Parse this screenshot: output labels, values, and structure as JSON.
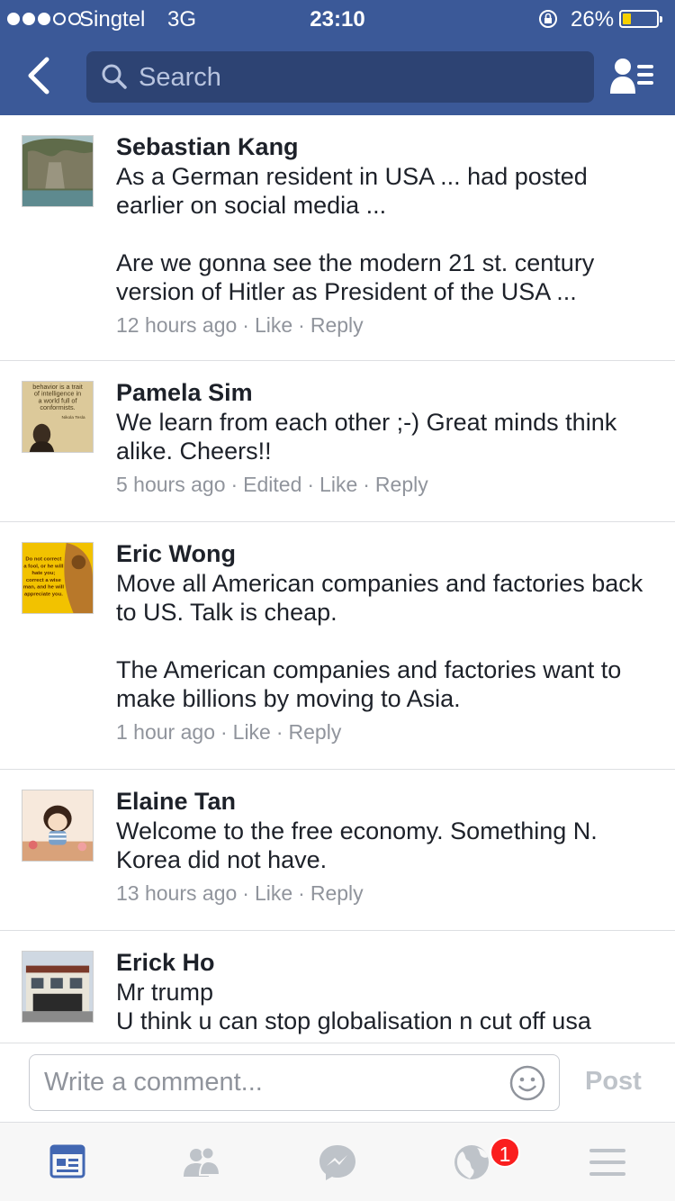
{
  "status_bar": {
    "carrier": "Singtel",
    "network": "3G",
    "time": "23:10",
    "battery_percent": "26%",
    "battery_level": 0.26,
    "signal_bars_filled": 3,
    "signal_bars_total": 5
  },
  "header": {
    "search_placeholder": "Search",
    "color": "#3b5998"
  },
  "comments": [
    {
      "name": "Sebastian Kang",
      "paragraphs": [
        "As a German resident in USA ... had posted earlier on social media ...",
        "Are we gonna see the modern 21 st. century version of Hitler as President of the USA ..."
      ],
      "time": "12 hours ago",
      "edited": "",
      "like": "Like",
      "reply": "Reply"
    },
    {
      "name": "Pamela Sim",
      "paragraphs": [
        "We learn from each other ;-) Great minds think alike. Cheers!!"
      ],
      "time": "5 hours ago",
      "edited": "Edited",
      "like": "Like",
      "reply": "Reply"
    },
    {
      "name": "Eric Wong",
      "paragraphs": [
        "Move all American companies and factories back to US. Talk is cheap.",
        "The American companies and factories want to make billions by moving to Asia."
      ],
      "time": "1 hour ago",
      "edited": "",
      "like": "Like",
      "reply": "Reply"
    },
    {
      "name": "Elaine Tan",
      "paragraphs": [
        "Welcome to the free economy. Something N. Korea did not have."
      ],
      "time": "13 hours ago",
      "edited": "",
      "like": "Like",
      "reply": "Reply"
    },
    {
      "name": "Erick Ho",
      "paragraphs": [
        "Mr trump",
        "U think u can stop globalisation n cut off usa"
      ],
      "time": "",
      "edited": "",
      "like": "",
      "reply": ""
    }
  ],
  "avatar_texts": {
    "pamela": [
      "behavior is a trait",
      "of intelligence in",
      "a world full of",
      "conformists.",
      "Nikola Tesla"
    ],
    "eric": [
      "Do not correct",
      "a fool, or he will",
      "hate you;",
      "correct a wise",
      "man, and he will",
      "appreciate you."
    ]
  },
  "composer": {
    "placeholder": "Write a comment...",
    "post_label": "Post"
  },
  "tabbar": {
    "tabs": [
      "news-feed-icon",
      "friend-requests-icon",
      "messenger-icon",
      "notifications-globe-icon",
      "more-menu-icon"
    ],
    "notification_count": "1",
    "active_color": "#4267b2",
    "inactive_color": "#bec3c9",
    "badge_color": "#fa1e1e"
  }
}
